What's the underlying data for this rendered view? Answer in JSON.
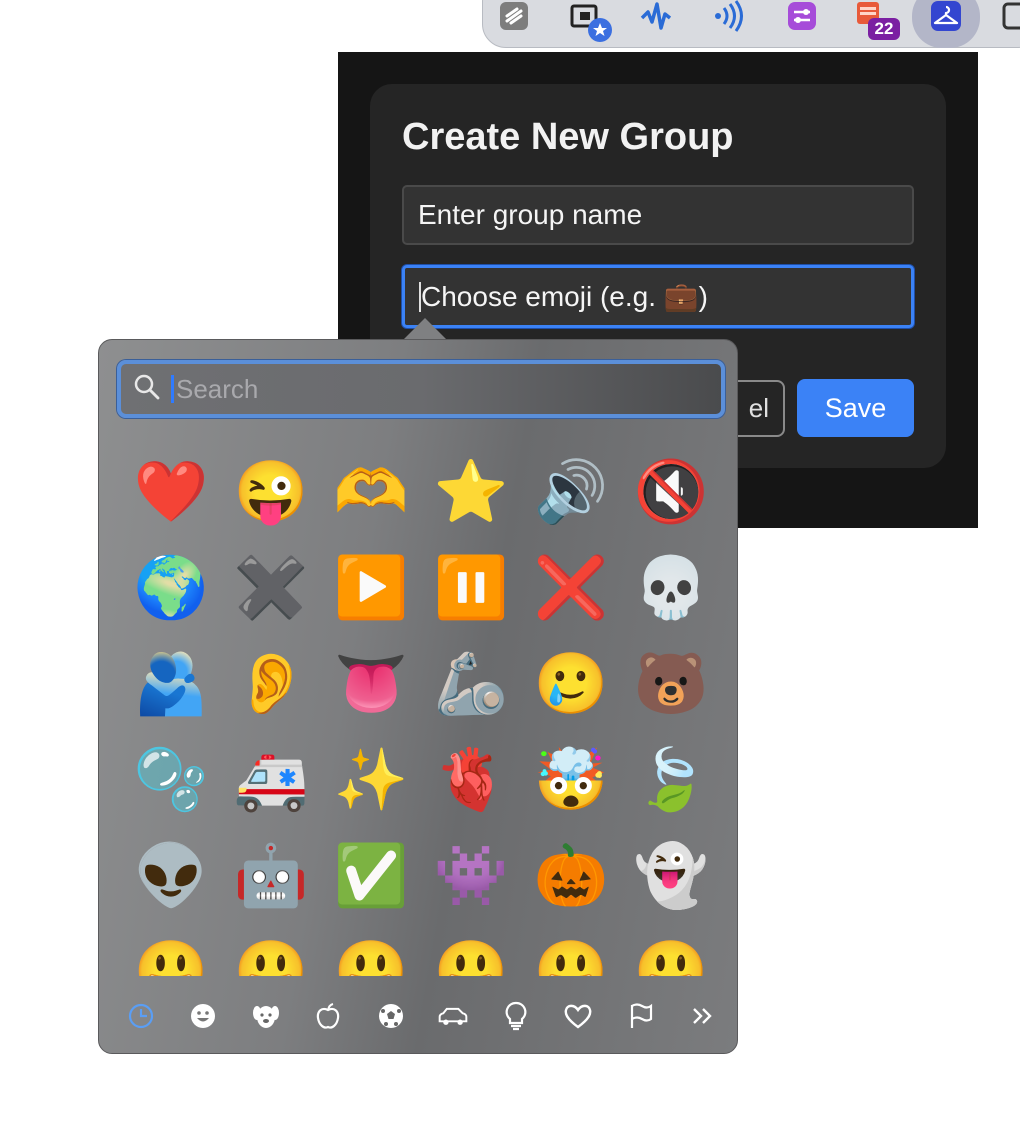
{
  "toolbar": {
    "badge_count": "22",
    "icons": [
      "notes-app-icon",
      "screen-window-star-icon",
      "audio-wave-icon",
      "wireless-signal-icon",
      "purple-settings-icon",
      "calendar-app-icon",
      "hanger-icon",
      "overflow-icon"
    ]
  },
  "dialog": {
    "title": "Create New Group",
    "group_name_placeholder": "Enter group name",
    "emoji_placeholder": "Choose emoji (e.g. 💼)",
    "cancel_label": "Cancel",
    "cancel_visible_text": "el",
    "save_label": "Save",
    "accent_color": "#3b82f6"
  },
  "picker": {
    "search_placeholder": "Search",
    "rows": [
      [
        "❤️",
        "😜",
        "🫶",
        "⭐",
        "🔊",
        "🔇"
      ],
      [
        "🌍",
        "✖️",
        "▶️",
        "⏸️",
        "❌",
        "💀"
      ],
      [
        "🫂",
        "👂",
        "👅",
        "🦾",
        "🥲",
        "🐻"
      ],
      [
        "🫧",
        "🚑",
        "✨",
        "🫀",
        "🤯",
        "🍃"
      ],
      [
        "👽",
        "🤖",
        "✅",
        "👾",
        "🎃",
        "👻"
      ],
      [
        "😃",
        "😃",
        "😃",
        "😃",
        "😃",
        "😃"
      ]
    ],
    "categories": [
      "recent-clock-icon",
      "smileys-icon",
      "animals-icon",
      "food-apple-icon",
      "activity-ball-icon",
      "travel-car-icon",
      "objects-bulb-icon",
      "symbols-heart-icon",
      "flags-icon",
      "more-chevrons-icon"
    ]
  }
}
